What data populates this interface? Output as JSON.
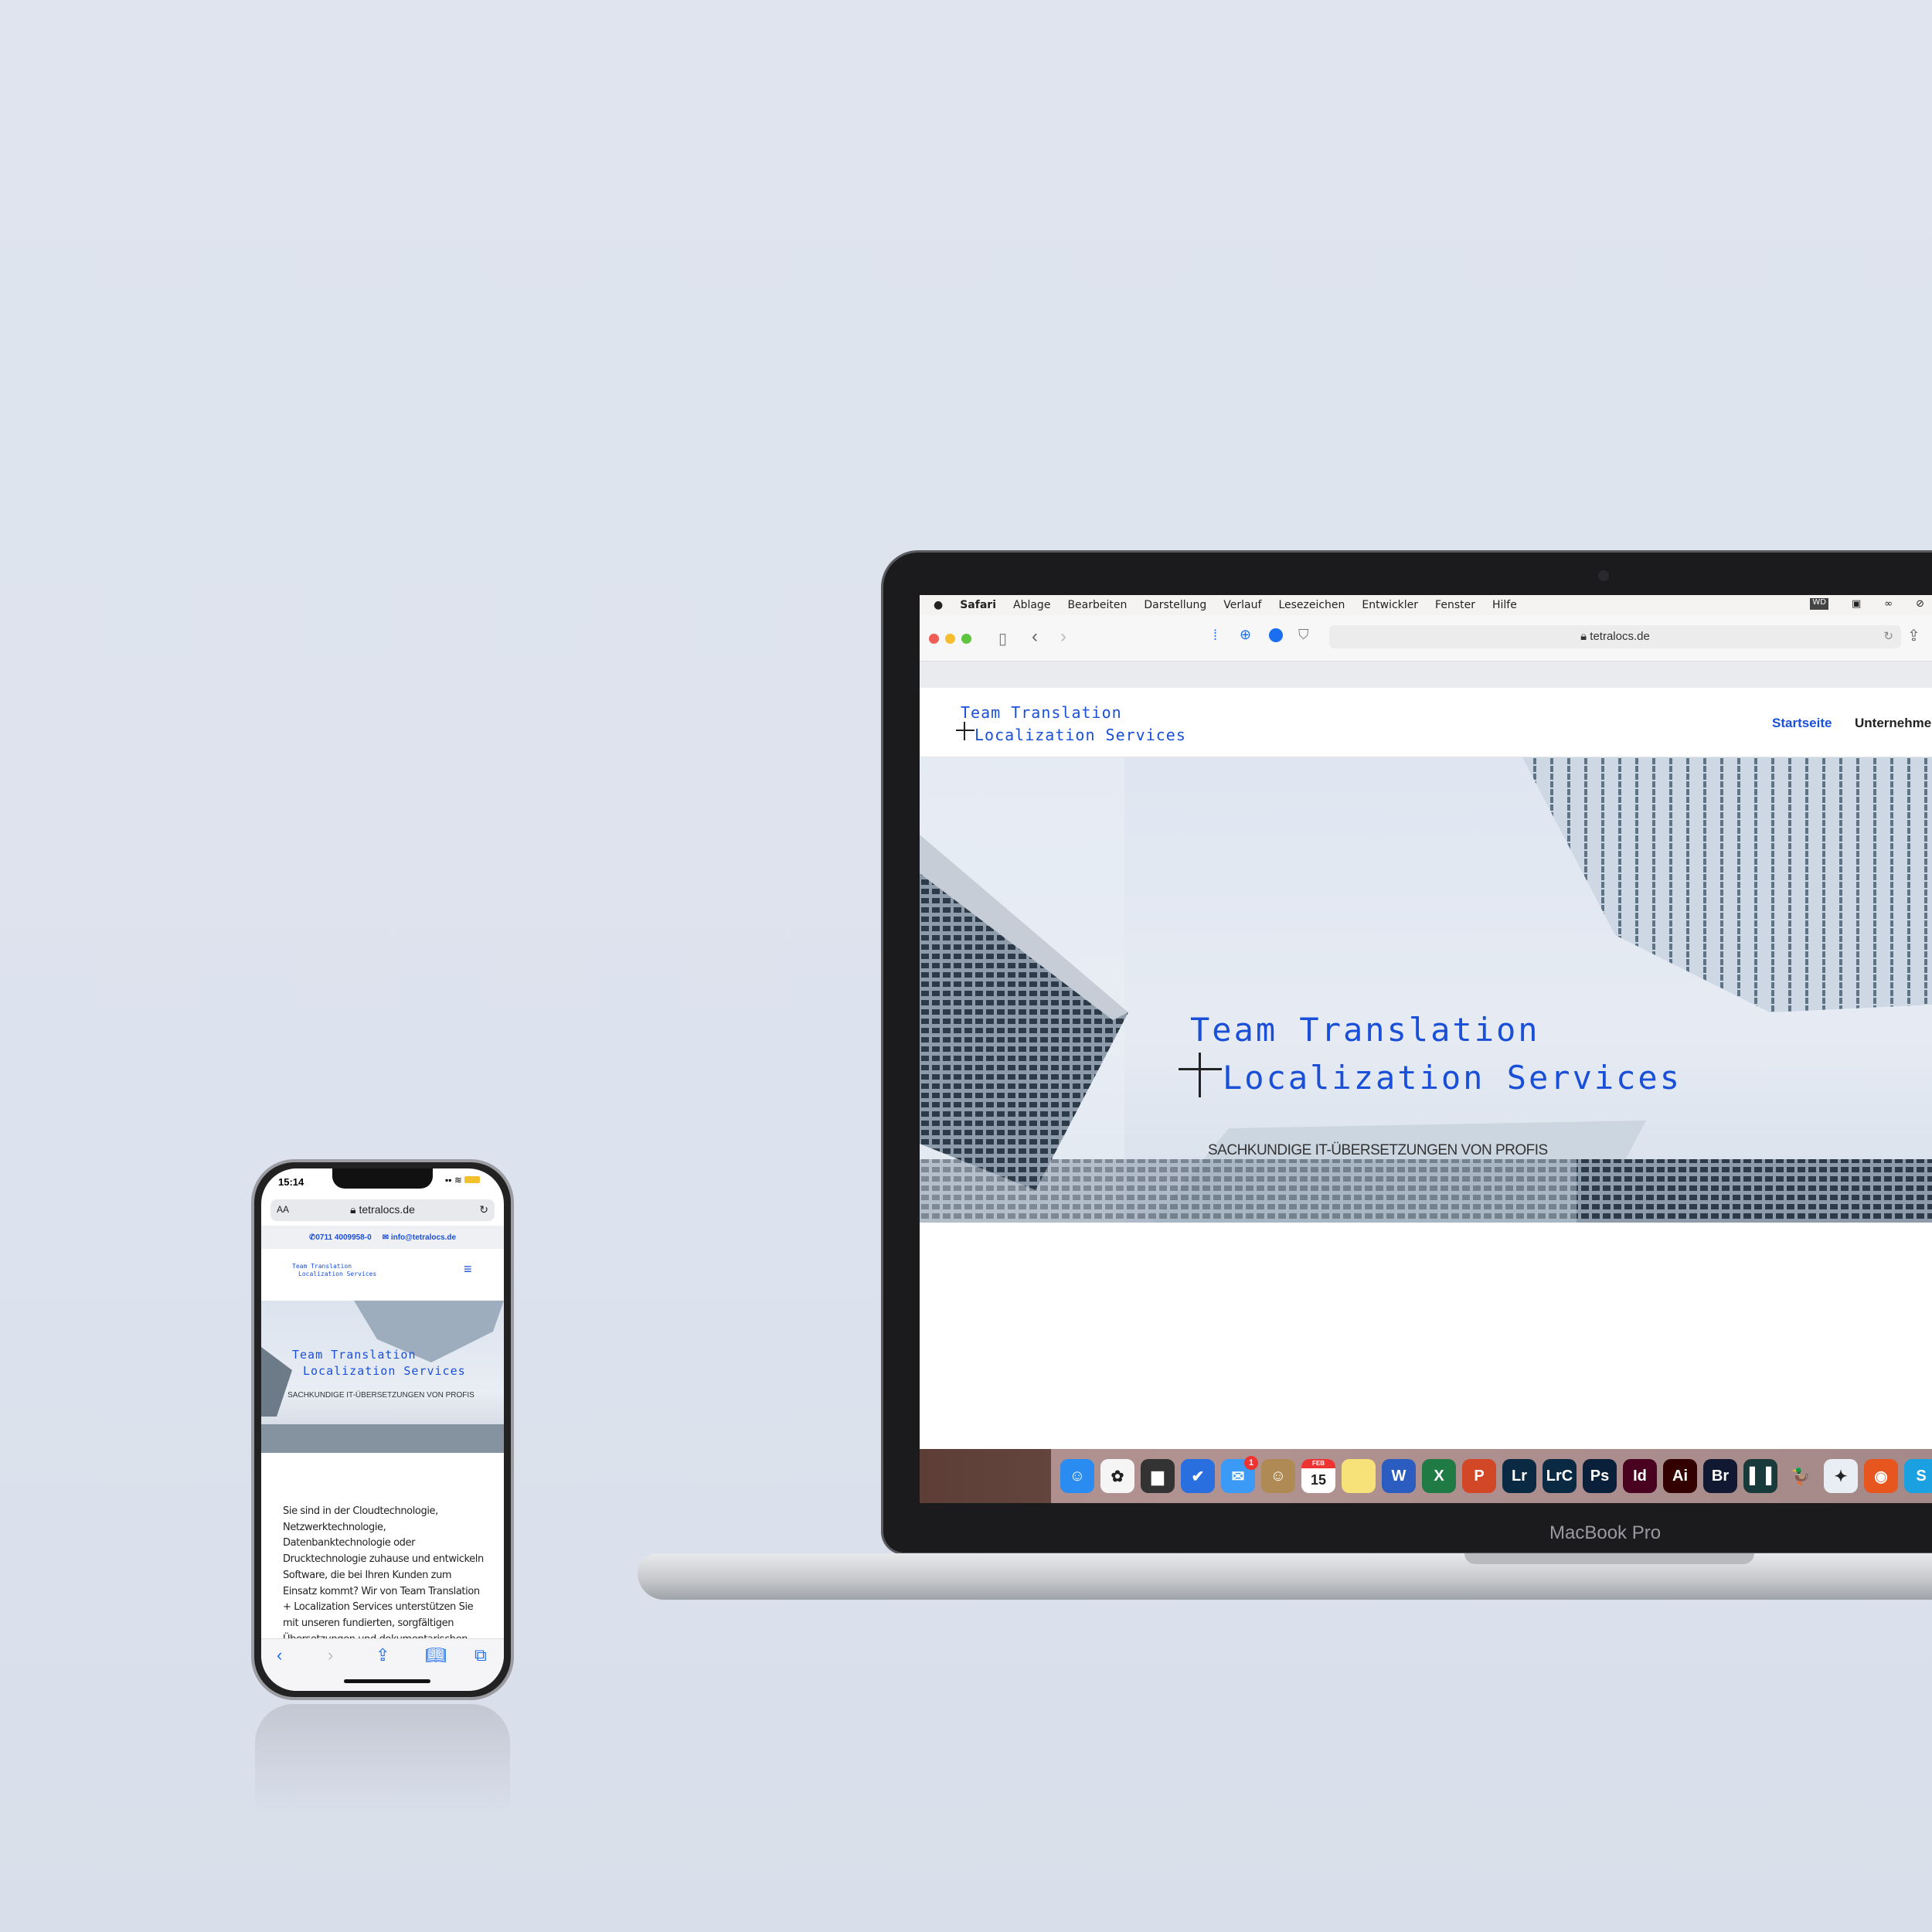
{
  "laptop": {
    "menubar": {
      "app": "Safari",
      "items": [
        "Ablage",
        "Bearbeiten",
        "Darstellung",
        "Verlauf",
        "Lesezeichen",
        "Entwickler",
        "Fenster",
        "Hilfe"
      ],
      "status_icons": [
        "wd-icon",
        "bridge-icon",
        "creative-cloud-icon",
        "shield-icon"
      ]
    },
    "browser": {
      "url": "tetralocs.de",
      "extensions": [
        "extension-icon",
        "target-icon",
        "info-icon",
        "shield-icon"
      ]
    },
    "site": {
      "logo_line1": "Team Translation",
      "logo_line2": "Localization Services",
      "nav": [
        "Startseite",
        "Unternehme"
      ],
      "nav_active_color": "#1a4fd8",
      "hero": {
        "title_line1": "Team Translation",
        "title_line2": "Localization Services",
        "subtitle": "SACHKUNDIGE IT-ÜBERSETZUNGEN VON PROFIS"
      }
    },
    "dock": [
      {
        "name": "finder",
        "label": "☺",
        "color": "#2a8cf0"
      },
      {
        "name": "photos",
        "label": "✿",
        "color": "#f5f5f5"
      },
      {
        "name": "printer",
        "label": "▆",
        "color": "#333"
      },
      {
        "name": "todo",
        "label": "✔",
        "color": "#2a6fe0"
      },
      {
        "name": "mail",
        "label": "✉",
        "color": "#3a9af5",
        "badge": "1"
      },
      {
        "name": "contacts",
        "label": "☺",
        "color": "#b08a55"
      },
      {
        "name": "calendar",
        "label": "15",
        "month": "FEB",
        "color": "#ffffff"
      },
      {
        "name": "notes",
        "label": "",
        "color": "#f7e27a"
      },
      {
        "name": "word",
        "label": "W",
        "color": "#2b5cbf"
      },
      {
        "name": "excel",
        "label": "X",
        "color": "#1f7a43"
      },
      {
        "name": "powerpoint",
        "label": "P",
        "color": "#d24726"
      },
      {
        "name": "lightroom",
        "label": "Lr",
        "color": "#0a2a44"
      },
      {
        "name": "lightroom-classic",
        "label": "LrC",
        "color": "#0a2a44"
      },
      {
        "name": "photoshop",
        "label": "Ps",
        "color": "#0a1f3a"
      },
      {
        "name": "indesign",
        "label": "Id",
        "color": "#49021f"
      },
      {
        "name": "illustrator",
        "label": "Ai",
        "color": "#330000"
      },
      {
        "name": "bridge",
        "label": "Br",
        "color": "#111831"
      },
      {
        "name": "dash",
        "label": "▌▐",
        "color": "#183a3a"
      },
      {
        "name": "cyberduck",
        "label": "🦆",
        "color": "transparent"
      },
      {
        "name": "safari",
        "label": "✦",
        "color": "#e9eef5"
      },
      {
        "name": "firefox",
        "label": "◉",
        "color": "#e8561f"
      },
      {
        "name": "skype",
        "label": "S",
        "color": "#1ba1e2"
      }
    ],
    "label": "MacBook Pro"
  },
  "phone": {
    "time": "15:14",
    "url": "tetralocs.de",
    "text_size": "AA",
    "phone_number": "0711 4009958-0",
    "email": "info@tetralocs.de",
    "logo_line1": "Team Translation",
    "logo_line2": "Localization Services",
    "hero": {
      "title_line1": "Team Translation",
      "title_line2": "Localization Services",
      "subtitle": "SACHKUNDIGE IT-ÜBERSETZUNGEN VON PROFIS"
    },
    "body_text": "Sie sind in der Cloudtechnologie, Netzwerktechnologie, Datenbanktechnologie oder Drucktechnologie zuhause und entwickeln Software, die bei Ihren Kunden zum Einsatz kommt? Wir von Team Translation + Localization Services unterstützen Sie mit unseren fundierten, sorgfältigen Übersetzungen und dokumentarischen"
  }
}
